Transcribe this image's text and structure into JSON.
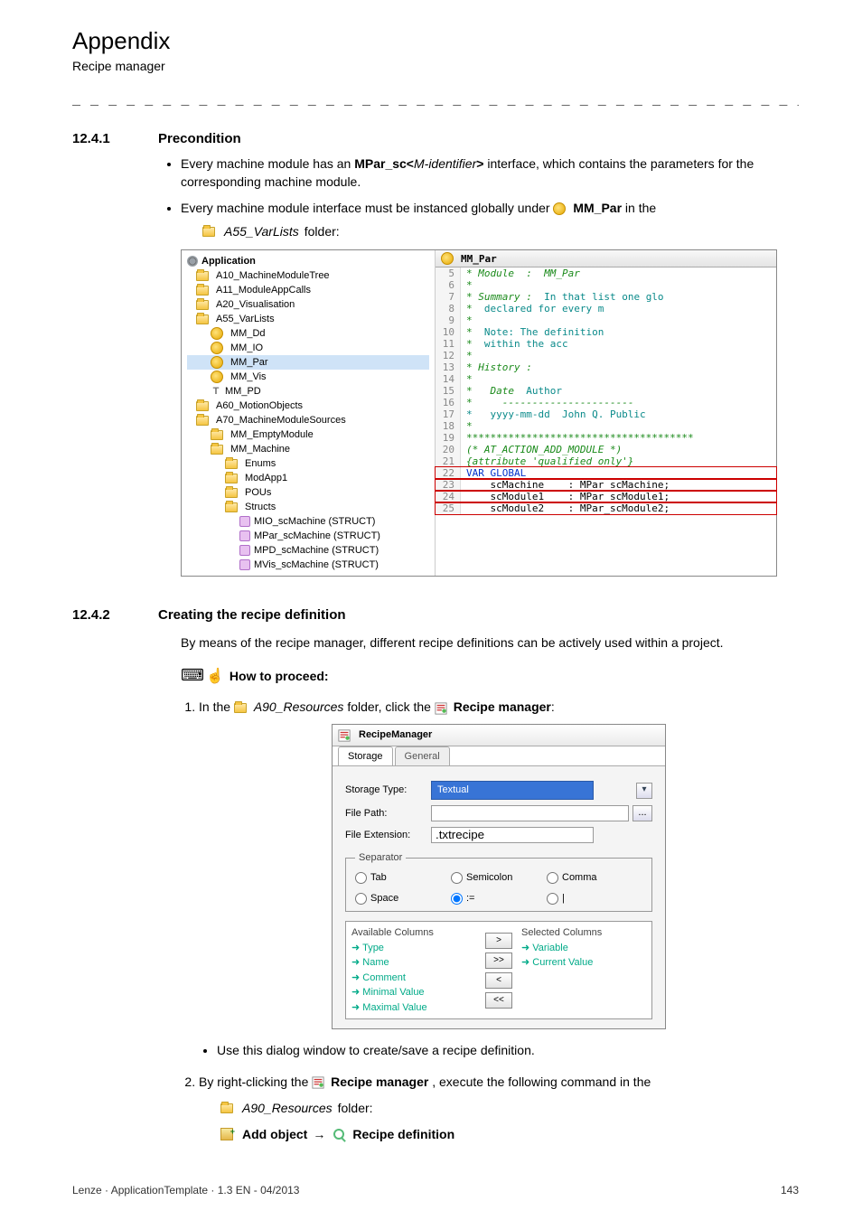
{
  "header": {
    "title": "Appendix",
    "sub": "Recipe manager"
  },
  "dashes": "_ _ _ _ _ _ _ _ _ _ _ _ _ _ _ _ _ _ _ _ _ _ _ _ _ _ _ _ _ _ _ _ _ _ _ _ _ _ _ _ _ _ _ _ _ _ _ _ _ _ _ _ _ _ _ _ _ _ _ _ _ _ _ _",
  "s1": {
    "num": "12.4.1",
    "title": "Precondition",
    "bullet1a": "Every machine module has an ",
    "bullet1b": "MPar_sc<",
    "bullet1c": "M-identifier",
    "bullet1d": ">",
    "bullet1e": " interface, which contains the parameters for the corresponding machine module.",
    "bullet2a": "Every machine module interface must be instanced globally under ",
    "bullet2b": " MM_Par",
    "bullet2c": " in the ",
    "sub1a": "A55_VarLists",
    "sub1b": " folder:"
  },
  "tree": {
    "root": "Application",
    "items": [
      "A10_MachineModuleTree",
      "A11_ModuleAppCalls",
      "A20_Visualisation",
      "A55_VarLists"
    ],
    "vars": [
      "MM_Dd",
      "MM_IO",
      "MM_Par",
      "MM_Vis",
      "MM_PD"
    ],
    "items2": [
      "A60_MotionObjects",
      "A70_MachineModuleSources"
    ],
    "mm": [
      "MM_EmptyModule",
      "MM_Machine"
    ],
    "sub": [
      "Enums",
      "ModApp1",
      "POUs",
      "Structs"
    ],
    "structs": [
      "MIO_scMachine (STRUCT)",
      "MPar_scMachine (STRUCT)",
      "MPD_scMachine (STRUCT)",
      "MVis_scMachine (STRUCT)"
    ]
  },
  "code": {
    "tab": "MM_Par",
    "lines": [
      {
        "n": "5",
        "t": "* Module  :",
        "r": "MM_Par",
        "cls": "cgreen"
      },
      {
        "n": "6",
        "t": "*",
        "cls": "cgreen"
      },
      {
        "n": "7",
        "t": "* Summary :",
        "r": "In that list one glo",
        "cls": "cgreen",
        "rcls": "cteal"
      },
      {
        "n": "8",
        "t": "*",
        "r": "declared for every m",
        "cls": "cgreen",
        "rcls": "cteal"
      },
      {
        "n": "9",
        "t": "*",
        "cls": "cgreen"
      },
      {
        "n": "10",
        "t": "*",
        "r": "Note: The definition",
        "cls": "cgreen",
        "rcls": "cteal"
      },
      {
        "n": "11",
        "t": "*",
        "r": "within the acc",
        "cls": "cgreen",
        "rcls": "cteal"
      },
      {
        "n": "12",
        "t": "*",
        "cls": "cgreen"
      },
      {
        "n": "13",
        "t": "* History :",
        "cls": "cgreen"
      },
      {
        "n": "14",
        "t": "*",
        "cls": "cgreen"
      },
      {
        "n": "15",
        "t": "*   Date",
        "r": "Author",
        "cls": "cgreen",
        "rcls": "cteal"
      },
      {
        "n": "16",
        "t": "*   ",
        "r": "----------------------",
        "cls": "cgreen"
      },
      {
        "n": "17",
        "t": "*   yyyy-mm-dd  John Q. Public",
        "cls": "cteal"
      },
      {
        "n": "18",
        "t": "*",
        "cls": "cgreen"
      },
      {
        "n": "19",
        "t": "**************************************",
        "cls": "cgreen"
      },
      {
        "n": "20",
        "t": "(* AT_ACTION_ADD_MODULE *)",
        "cls": "cgreen"
      },
      {
        "n": "21",
        "t": "{attribute 'qualified_only'}",
        "cls": "cgreen"
      },
      {
        "n": "22",
        "t": "VAR_GLOBAL",
        "cls": "cblue",
        "box": true
      },
      {
        "n": "23",
        "t": "    scMachine    : MPar_scMachine;",
        "box": true
      },
      {
        "n": "24",
        "t": "    scModule1    : MPar_scModule1;",
        "box": true
      },
      {
        "n": "25",
        "t": "    scModule2    : MPar_scModule2;",
        "box": true
      }
    ]
  },
  "s2": {
    "num": "12.4.2",
    "title": "Creating the recipe definition",
    "intro": "By means of the recipe manager, different recipe definitions can be actively used within a project.",
    "how": "How to proceed:",
    "step1a": "In the ",
    "step1b": "A90_Resources",
    "step1c": " folder, click the ",
    "step1d": "Recipe manager",
    "step1e": ":",
    "note": "Use this dialog window to create/save a recipe definition.",
    "step2a": "By right-clicking the ",
    "step2b": "Recipe manager",
    "step2c": " , execute the following command in the ",
    "step2sub_a": "A90_Resources",
    "step2sub_b": "  folder:",
    "step2sub2a": "Add object",
    "step2sub2b": "→",
    "step2sub2c": " Recipe definition"
  },
  "dialog": {
    "title": "RecipeManager",
    "tab1": "Storage",
    "tab2": "General",
    "storageType": "Storage Type:",
    "storageTypeVal": "Textual",
    "filePath": "File Path:",
    "fileExt": "File Extension:",
    "fileExtVal": ".txtrecipe",
    "sep": "Separator",
    "r1": "Tab",
    "r2": "Semicolon",
    "r3": "Comma",
    "r4": "Space",
    "r5": ":=",
    "r6": "|",
    "avail": "Available Columns",
    "selcol": "Selected Columns",
    "a": [
      "Type",
      "Name",
      "Comment",
      "Minimal Value",
      "Maximal Value"
    ],
    "s": [
      "Variable",
      "Current Value"
    ],
    "btns": [
      ">",
      ">>",
      "<",
      "<<"
    ]
  },
  "footer": {
    "left": "Lenze · ApplicationTemplate · 1.3 EN - 04/2013",
    "right": "143"
  }
}
